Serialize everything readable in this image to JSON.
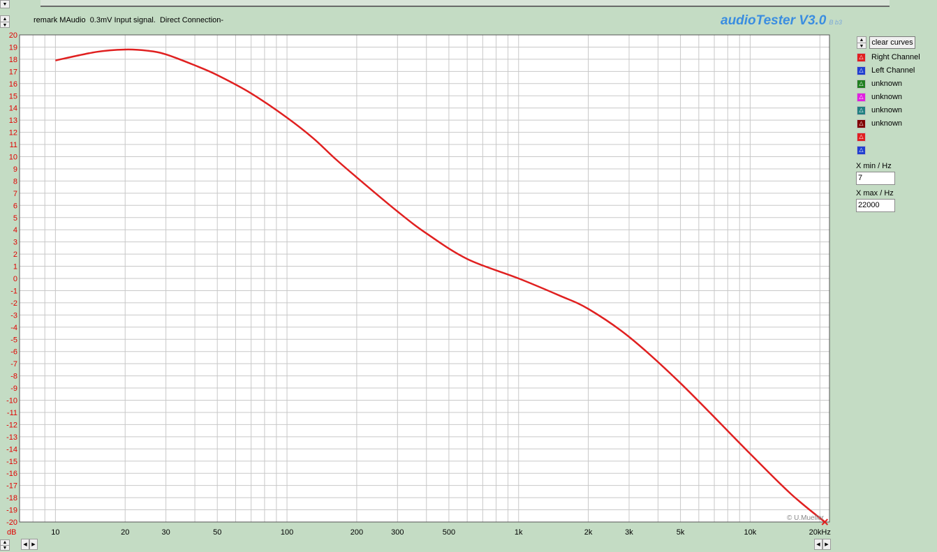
{
  "header": {
    "remark": "remark MAudio  0.3mV Input signal.  Direct Connection-",
    "app_title": "audioTester V3.0",
    "app_subtitle": "B b3"
  },
  "legend": {
    "clear_button": "clear curves",
    "channels": [
      {
        "label": "Right Channel",
        "color": "#e02020"
      },
      {
        "label": "Left Channel",
        "color": "#2040d0"
      },
      {
        "label": "unknown",
        "color": "#208020"
      },
      {
        "label": "unknown",
        "color": "#e020e0"
      },
      {
        "label": "unknown",
        "color": "#208080"
      },
      {
        "label": "unknown",
        "color": "#800000"
      },
      {
        "label": "",
        "color": "#e02020"
      },
      {
        "label": "",
        "color": "#2040d0"
      }
    ],
    "swatch_icon": "triangle-icon"
  },
  "x_controls": {
    "xmin_label": "X min / Hz",
    "xmin_value": "7",
    "xmax_label": "X max / Hz",
    "xmax_value": "22000"
  },
  "watermark": "© U.Mueller",
  "colors": {
    "background": "#c4dcc4",
    "axis_text": "#e00000",
    "curve": "#e02020",
    "grid": "#c8c8c8"
  },
  "chart_data": {
    "type": "line",
    "x_scale": "log",
    "xlim": [
      7,
      22000
    ],
    "ylim": [
      -20,
      20
    ],
    "ylabel": "dB",
    "grid": true,
    "y_ticks": [
      20,
      19,
      18,
      17,
      16,
      15,
      14,
      13,
      12,
      11,
      10,
      9,
      8,
      7,
      6,
      5,
      4,
      3,
      2,
      1,
      0,
      -1,
      -2,
      -3,
      -4,
      -5,
      -6,
      -7,
      -8,
      -9,
      -10,
      -11,
      -12,
      -13,
      -14,
      -15,
      -16,
      -17,
      -18,
      -19,
      -20
    ],
    "x_ticks": [
      {
        "v": 10,
        "label": "10"
      },
      {
        "v": 20,
        "label": "20"
      },
      {
        "v": 30,
        "label": "30"
      },
      {
        "v": 50,
        "label": "50"
      },
      {
        "v": 100,
        "label": "100"
      },
      {
        "v": 200,
        "label": "200"
      },
      {
        "v": 300,
        "label": "300"
      },
      {
        "v": 500,
        "label": "500"
      },
      {
        "v": 1000,
        "label": "1k"
      },
      {
        "v": 2000,
        "label": "2k"
      },
      {
        "v": 3000,
        "label": "3k"
      },
      {
        "v": 5000,
        "label": "5k"
      },
      {
        "v": 10000,
        "label": "10k"
      },
      {
        "v": 20000,
        "label": "20kHz"
      }
    ],
    "series": [
      {
        "name": "Right Channel",
        "x": [
          10,
          15,
          20,
          25,
          30,
          40,
          50,
          70,
          100,
          130,
          160,
          200,
          300,
          400,
          600,
          1000,
          1500,
          2000,
          3000,
          5000,
          10000,
          15000,
          21000
        ],
        "y": [
          17.9,
          18.6,
          18.8,
          18.7,
          18.4,
          17.5,
          16.7,
          15.2,
          13.2,
          11.5,
          9.9,
          8.3,
          5.5,
          3.7,
          1.6,
          0.0,
          -1.4,
          -2.5,
          -4.8,
          -8.6,
          -14.4,
          -17.7,
          -20.0
        ]
      }
    ]
  }
}
